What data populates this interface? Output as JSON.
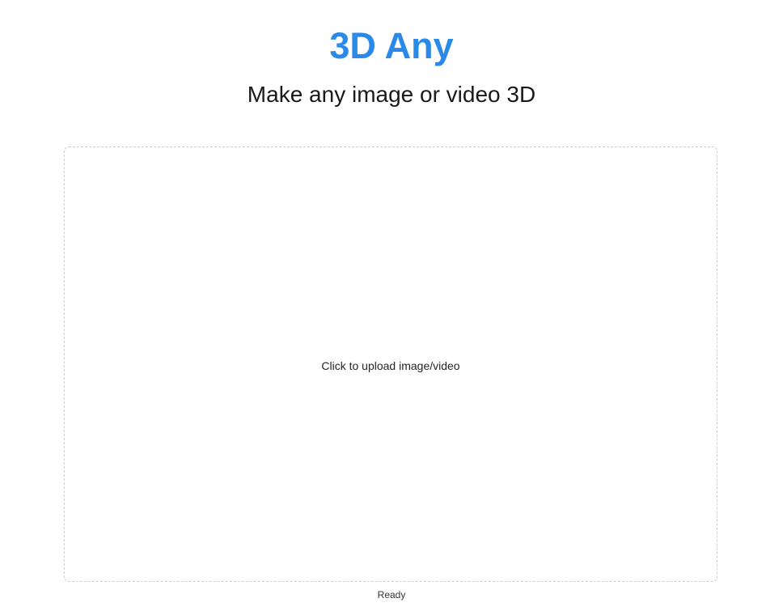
{
  "header": {
    "title": "3D Any",
    "subtitle": "Make any image or video 3D"
  },
  "upload": {
    "label": "Click to upload image/video"
  },
  "status": {
    "text": "Ready"
  },
  "colors": {
    "accent": "#2b8ae8",
    "text": "#1a1a1a",
    "border": "#cfcfcf",
    "background": "#ffffff"
  }
}
